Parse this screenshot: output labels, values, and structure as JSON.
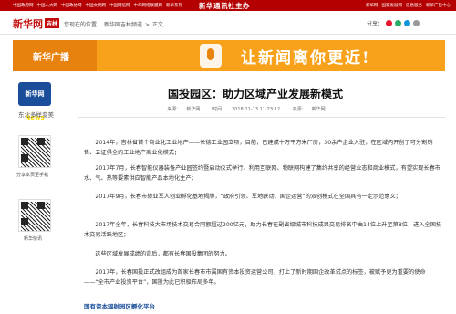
{
  "topbar": {
    "links": [
      "中国政府网",
      "中国人大网",
      "中国政协网",
      "中国文明网",
      "中国网信网",
      "中华网络联盟网",
      "新华系列"
    ],
    "center": "新华通讯社主办",
    "right": [
      "新华网",
      "国家发展网",
      "信息服务",
      "新华广告中心"
    ]
  },
  "header": {
    "logo_text": "新华网",
    "logo_tag": "吉林",
    "breadcrumb_prefix": "您现在的位置：",
    "breadcrumb_home": "新华网吉林频道",
    "breadcrumb_sep": ">",
    "breadcrumb_current": "正文",
    "share_label": "分享："
  },
  "banner": {
    "brand": "新华广播",
    "slogan": "让新闻离你更近!"
  },
  "newslogo": {
    "badge": "新华网",
    "sub": "News",
    "tagline": "东北多样变美"
  },
  "article": {
    "title": "国投园区：助力区域产业发展新模式",
    "source_label": "来源：",
    "source": "新华网",
    "time_label": "时间：",
    "time": "2018-11-13 11:23:12",
    "origin_label": "来源：",
    "origin": "新华网",
    "paragraphs": [
      "2014年，吉林省首个商业化工业地产——长德工业园立项，目前，已建成十万平方米厂房，30余户企业入驻，在区域内开创了可分割销售、五证俱全的工业地产商业化模式；",
      "2017年7月，长春智能仪器装备产业园签约暨启动仪式举行，利用互联网、物联网构建了集约共享的经营业态和商业模式，有望实现长春市水、气、热等要素供应智能产品本地化生产；",
      "2017年9月，长春市转业军人创业孵化基地揭牌，“政府引领、军地联动、国企运营”的双创模式在全国具有一定示范意义；",
      "2017年全年，长春科技大市场技术交易合同额超过200亿元，助力长春在副省级城市科技成果交易排名中由14位上升至第8位，进入全国技术交易活跃地区；",
      "这些区域发展成绩的背后，都有长春国投集团的努力。",
      "2017年，长春国投正式改组成为首家长春市市属国有资本投资运营公司，打上了新时期国企改革试点的标签，被赋予更为重要的使命——“全市产业投资平台”，国投为此已积极布局多年。"
    ],
    "subhead": "国有资本辐射园区孵化平台"
  },
  "sidebar": {
    "qr1_label": "分享本页至手机",
    "qr2_label": "新华快讯"
  }
}
